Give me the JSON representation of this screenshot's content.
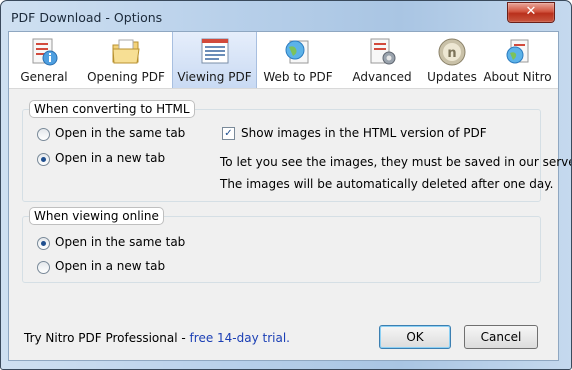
{
  "window": {
    "title": "PDF Download - Options",
    "close_glyph": "✕"
  },
  "tabs": [
    {
      "label": "General",
      "icon": "general-icon",
      "selected": false
    },
    {
      "label": "Opening PDF",
      "icon": "folder-icon",
      "selected": false
    },
    {
      "label": "Viewing PDF",
      "icon": "document-view-icon",
      "selected": true
    },
    {
      "label": "Web to PDF",
      "icon": "globe-icon",
      "selected": false
    },
    {
      "label": "Advanced",
      "icon": "gear-document-icon",
      "selected": false
    },
    {
      "label": "Updates",
      "icon": "nitro-icon",
      "selected": false
    },
    {
      "label": "About Nitro",
      "icon": "info-globe-icon",
      "selected": false
    }
  ],
  "converting_group": {
    "title": "When converting to HTML",
    "options": [
      {
        "label": "Open in the same tab",
        "selected": false
      },
      {
        "label": "Open in a new tab",
        "selected": true
      }
    ],
    "show_images_label": "Show images in the HTML version of PDF",
    "show_images_checked": true,
    "info_lines": [
      "To let you see the images, they must be saved in our server.",
      "The images will be automatically deleted after one day."
    ]
  },
  "online_group": {
    "title": "When viewing online",
    "options": [
      {
        "label": "Open in the same tab",
        "selected": true
      },
      {
        "label": "Open in a new tab",
        "selected": false
      }
    ]
  },
  "footer": {
    "promo_text": "Try Nitro PDF Professional -",
    "trial_link": "free 14-day trial.",
    "ok_label": "OK",
    "cancel_label": "Cancel"
  },
  "colors": {
    "link": "#1b3fb5",
    "titlebar": "#b8d0ea",
    "close_button": "#c9563f"
  }
}
